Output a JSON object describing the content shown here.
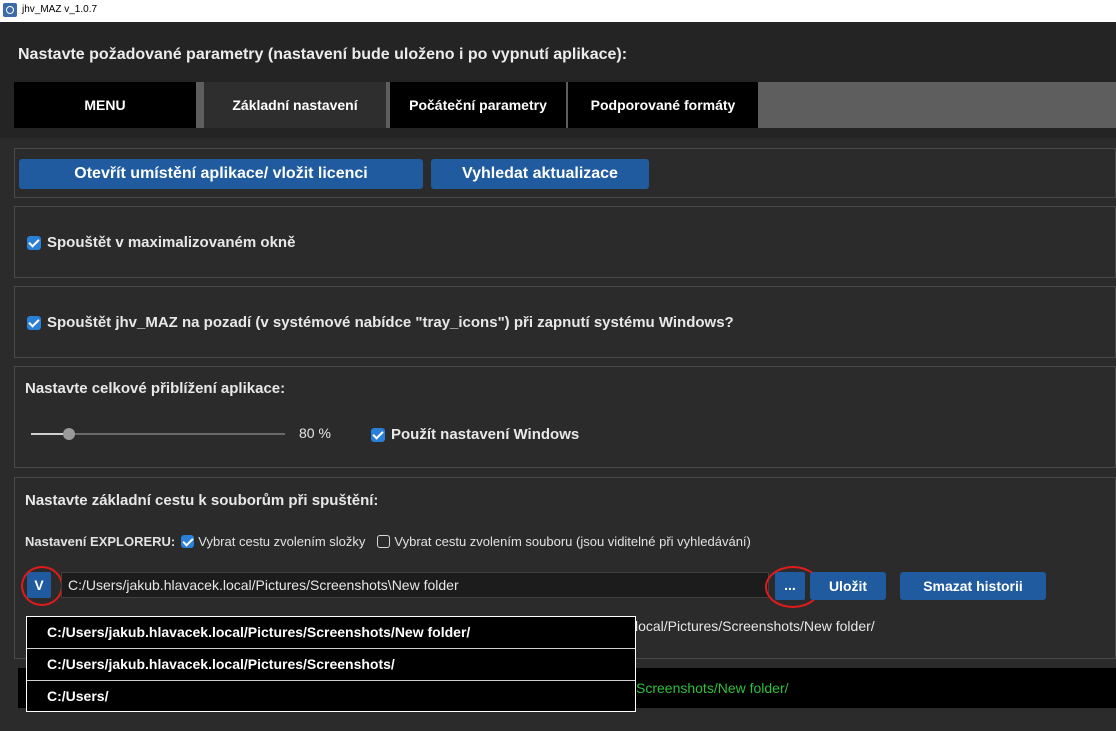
{
  "window": {
    "title": "jhv_MAZ v_1.0.7"
  },
  "header": {
    "heading": "Nastavte požadované parametry (nastavení bude uloženo i po vypnutí aplikace):"
  },
  "tabs": [
    {
      "label": "MENU"
    },
    {
      "label": "Základní nastavení"
    },
    {
      "label": "Počáteční parametry"
    },
    {
      "label": "Podporované formáty"
    }
  ],
  "actions": {
    "open_location_label": "Otevřít umístění aplikace/ vložit licenci",
    "check_updates_label": "Vyhledat aktualizace"
  },
  "options": {
    "maximized": {
      "label": "Spouštět v maximalizovaném okně",
      "checked": true
    },
    "tray": {
      "label": "Spouštět jhv_MAZ na pozadí (v systémové nabídce \"tray_icons\") při zapnutí systému Windows?",
      "checked": true
    }
  },
  "zoom": {
    "heading": "Nastavte celkové přiblížení aplikace:",
    "value_label": "80 %",
    "slider_fraction": 0.15,
    "use_windows_label": "Použít nastavení Windows",
    "use_windows_checked": true
  },
  "path": {
    "heading": "Nastavte základní cestu k souborům při spuštění:",
    "explorer_label": "Nastavení EXPLORERU:",
    "select_folder_label": "Vybrat cestu zvolením složky",
    "select_folder_checked": true,
    "select_file_label": "Vybrat cestu zvolením souboru (jsou viditelné při vyhledávání)",
    "select_file_checked": false,
    "history_button_label": "V",
    "input_value": "C:/Users/jakub.hlavacek.local/Pictures/Screenshots\\New folder",
    "browse_label": "...",
    "save_label": "Uložit",
    "clear_history_label": "Smazat historii",
    "current_path_visible": "local/Pictures/Screenshots/New folder/",
    "history": [
      "C:/Users/jakub.hlavacek.local/Pictures/Screenshots/New folder/",
      "C:/Users/jakub.hlavacek.local/Pictures/Screenshots/",
      "C:/Users/"
    ]
  },
  "status": {
    "text_visible": "Screenshots/New folder/",
    "color": "#2fbf3a"
  },
  "colors": {
    "accent": "#1f5b9e",
    "highlight": "#e01b1b"
  }
}
